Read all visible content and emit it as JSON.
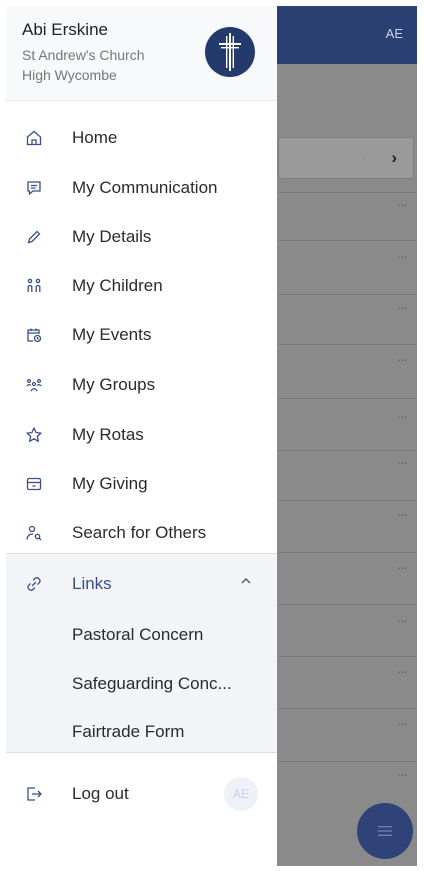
{
  "background": {
    "header_initials": "AE",
    "pager": {
      "prev_symbol": "‹",
      "next_symbol": "›"
    },
    "row_more": "···"
  },
  "user": {
    "name": "Abi Erskine",
    "church_line1": "St Andrew's Church",
    "church_line2": "High Wycombe"
  },
  "nav": {
    "items": [
      {
        "label": "Home",
        "icon": "home-icon"
      },
      {
        "label": "My Communication",
        "icon": "message-icon"
      },
      {
        "label": "My Details",
        "icon": "pencil-icon"
      },
      {
        "label": "My Children",
        "icon": "children-icon"
      },
      {
        "label": "My Events",
        "icon": "calendar-clock-icon"
      },
      {
        "label": "My Groups",
        "icon": "group-icon"
      },
      {
        "label": "My Rotas",
        "icon": "star-icon"
      },
      {
        "label": "My Giving",
        "icon": "wallet-icon"
      },
      {
        "label": "Search for Others",
        "icon": "person-search-icon"
      }
    ]
  },
  "links": {
    "label": "Links",
    "icon": "link-icon",
    "expanded": true,
    "items": [
      {
        "label": "Pastoral Concern"
      },
      {
        "label": "Safeguarding Conc..."
      },
      {
        "label": "Fairtrade Form"
      }
    ]
  },
  "logout": {
    "label": "Log out",
    "icon": "logout-icon",
    "avatar_initials": "AE"
  },
  "colors": {
    "brand": "#253a6c",
    "links_accent": "#3b4f86",
    "overlay": "#8a8a8a"
  }
}
